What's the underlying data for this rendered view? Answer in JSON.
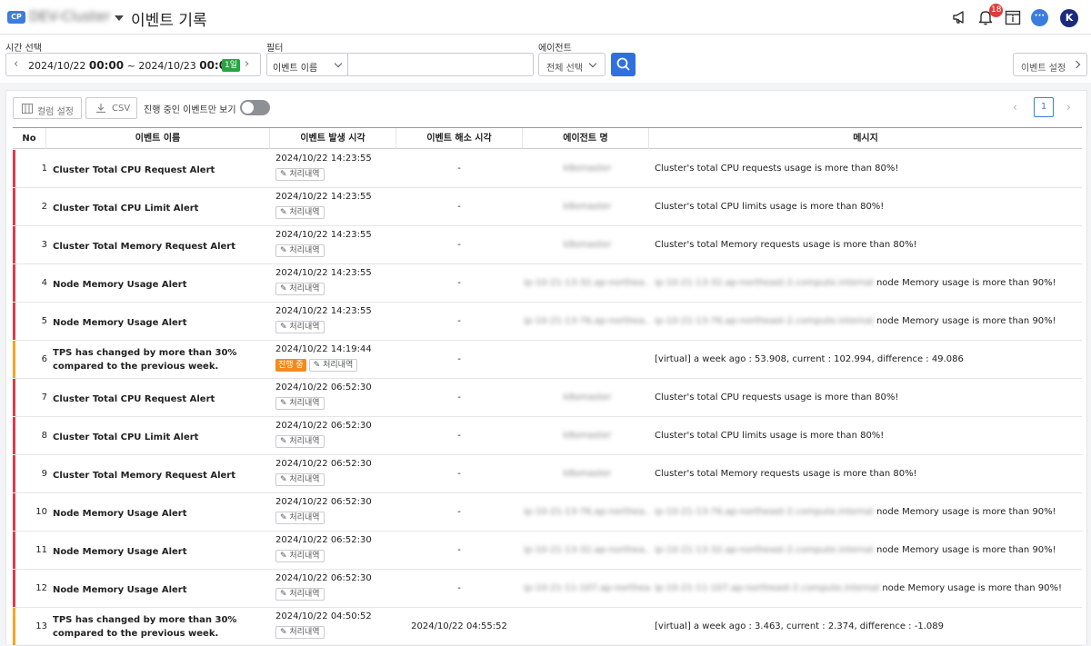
{
  "header": {
    "badge": "CP",
    "cluster": "DEV-Cluster",
    "title": "이벤트 기록",
    "notification_count": "18",
    "avatar_initial": "K",
    "chat_glyph": "···"
  },
  "filters": {
    "time_label": "시간 선택",
    "time_start_date": "2024/10/22",
    "time_start_time": "00:00",
    "time_sep": "~",
    "time_end_date": "2024/10/23",
    "time_end_time": "00:00",
    "day_tag": "1일",
    "filter_label": "필터",
    "filter_type": "이벤트 이름",
    "filter_value": "",
    "agent_label": "에이전트",
    "agent_value": "전체 선택",
    "settings_button": "이벤트 설정"
  },
  "toolbar": {
    "columns_button": "컬럼 설정",
    "csv_button": "CSV",
    "toggle_label": "진행 중인 이벤트만 보기",
    "page": "1"
  },
  "table": {
    "headers": [
      "No",
      "이벤트 이름",
      "이벤트 발생 시각",
      "이벤트 해소 시각",
      "에이전트 명",
      "메시지"
    ],
    "history_label": "처리내역",
    "in_progress_label": "진행 중",
    "rows": [
      {
        "no": "1",
        "name": "Cluster Total CPU Request Alert",
        "occurred": "2024/10/22 14:23:55",
        "resolved": "-",
        "agent": "k8smaster",
        "msg_prefix": "",
        "message": "Cluster's total CPU requests usage is more than 80%!",
        "severity": "#e03a4a",
        "in_progress": false
      },
      {
        "no": "2",
        "name": "Cluster Total CPU Limit Alert",
        "occurred": "2024/10/22 14:23:55",
        "resolved": "-",
        "agent": "k8smaster",
        "msg_prefix": "",
        "message": "Cluster's total CPU limits usage is more than 80%!",
        "severity": "#e03a4a",
        "in_progress": false
      },
      {
        "no": "3",
        "name": "Cluster Total Memory Request Alert",
        "occurred": "2024/10/22 14:23:55",
        "resolved": "-",
        "agent": "k8smaster",
        "msg_prefix": "",
        "message": "Cluster's total Memory requests usage is more than 80%!",
        "severity": "#e03a4a",
        "in_progress": false
      },
      {
        "no": "4",
        "name": "Node Memory Usage Alert",
        "occurred": "2024/10/22 14:23:55",
        "resolved": "-",
        "agent": "ip-10-21-13-32.ap-northea...",
        "msg_prefix": "ip-10-21-13-32.ap-northeast-2.compute.internal",
        "message": " node Memory usage is more than 90%!",
        "severity": "#e03a4a",
        "in_progress": false
      },
      {
        "no": "5",
        "name": "Node Memory Usage Alert",
        "occurred": "2024/10/22 14:23:55",
        "resolved": "-",
        "agent": "ip-10-21-13-76.ap-northea...",
        "msg_prefix": "ip-10-21-13-76.ap-northeast-2.compute.internal",
        "message": " node Memory usage is more than 90%!",
        "severity": "#e03a4a",
        "in_progress": false
      },
      {
        "no": "6",
        "name": "TPS has changed by more than 30% compared to the previous week.",
        "occurred": "2024/10/22 14:19:44",
        "resolved": "-",
        "agent": "",
        "msg_prefix": "",
        "message": "[virtual] a week ago : 53.908, current : 102.994, difference : 49.086",
        "severity": "#f5a623",
        "in_progress": true
      },
      {
        "no": "7",
        "name": "Cluster Total CPU Request Alert",
        "occurred": "2024/10/22 06:52:30",
        "resolved": "-",
        "agent": "k8smaster",
        "msg_prefix": "",
        "message": "Cluster's total CPU requests usage is more than 80%!",
        "severity": "#e03a4a",
        "in_progress": false
      },
      {
        "no": "8",
        "name": "Cluster Total CPU Limit Alert",
        "occurred": "2024/10/22 06:52:30",
        "resolved": "-",
        "agent": "k8smaster",
        "msg_prefix": "",
        "message": "Cluster's total CPU limits usage is more than 80%!",
        "severity": "#e03a4a",
        "in_progress": false
      },
      {
        "no": "9",
        "name": "Cluster Total Memory Request Alert",
        "occurred": "2024/10/22 06:52:30",
        "resolved": "-",
        "agent": "k8smaster",
        "msg_prefix": "",
        "message": "Cluster's total Memory requests usage is more than 80%!",
        "severity": "#e03a4a",
        "in_progress": false
      },
      {
        "no": "10",
        "name": "Node Memory Usage Alert",
        "occurred": "2024/10/22 06:52:30",
        "resolved": "-",
        "agent": "ip-10-21-13-76.ap-northea...",
        "msg_prefix": "ip-10-21-13-76.ap-northeast-2.compute.internal",
        "message": " node Memory usage is more than 90%!",
        "severity": "#e03a4a",
        "in_progress": false
      },
      {
        "no": "11",
        "name": "Node Memory Usage Alert",
        "occurred": "2024/10/22 06:52:30",
        "resolved": "-",
        "agent": "ip-10-21-13-32.ap-northea...",
        "msg_prefix": "ip-10-21-13-32.ap-northeast-2.compute.internal",
        "message": " node Memory usage is more than 90%!",
        "severity": "#e03a4a",
        "in_progress": false
      },
      {
        "no": "12",
        "name": "Node Memory Usage Alert",
        "occurred": "2024/10/22 06:52:30",
        "resolved": "-",
        "agent": "ip-10-21-11-107.ap-northea...",
        "msg_prefix": "ip-10-21-11-107.ap-northeast-2.compute.internal",
        "message": " node Memory usage is more than 90%!",
        "severity": "#e03a4a",
        "in_progress": false
      },
      {
        "no": "13",
        "name": "TPS has changed by more than 30% compared to the previous week.",
        "occurred": "2024/10/22 04:50:52",
        "resolved": "2024/10/22 04:55:52",
        "agent": "",
        "msg_prefix": "",
        "message": "[virtual] a week ago : 3.463, current : 2.374, difference : -1.089",
        "severity": "#f5a623",
        "in_progress": false
      }
    ]
  }
}
